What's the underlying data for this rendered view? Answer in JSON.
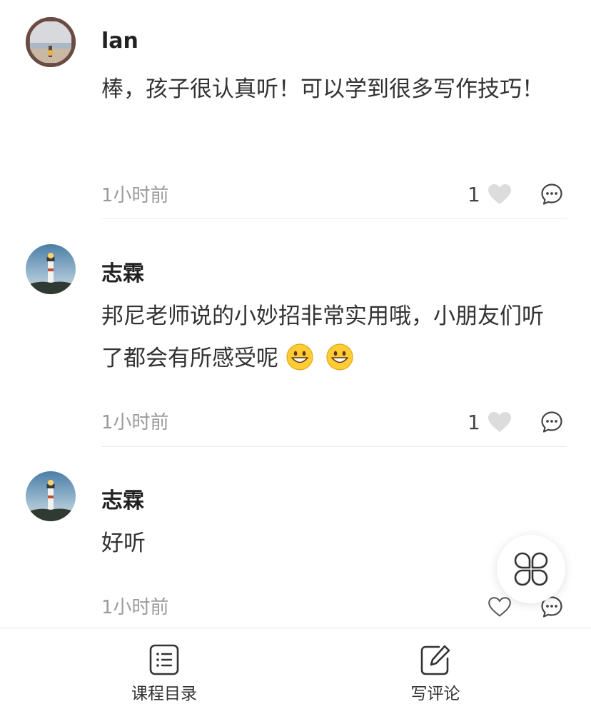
{
  "comments": [
    {
      "username": "lan",
      "content": "棒，孩子很认真听！可以学到很多写作技巧！",
      "time": "1小时前",
      "likes": "1",
      "liked": false
    },
    {
      "username": "志霖",
      "content": "邦尼老师说的小妙招非常实用哦，小朋友们听了都会有所感受呢",
      "content_emojis": [
        "grinning-face-emoji",
        "grinning-face-emoji"
      ],
      "time": "1小时前",
      "likes": "1",
      "liked": false
    },
    {
      "username": "志霖",
      "content": "好听",
      "time": "1小时前",
      "likes": "",
      "liked": false
    }
  ],
  "floating_button": {
    "icon": "four-petal-grid-icon"
  },
  "bottom_bar": {
    "catalog": {
      "label": "课程目录",
      "icon": "list-document-icon"
    },
    "write": {
      "label": "写评论",
      "icon": "edit-pen-icon"
    }
  },
  "colors": {
    "text_primary": "#222222",
    "text_secondary": "#9a9a9a",
    "heart": "#dcdcdc",
    "divider": "#ececec"
  }
}
